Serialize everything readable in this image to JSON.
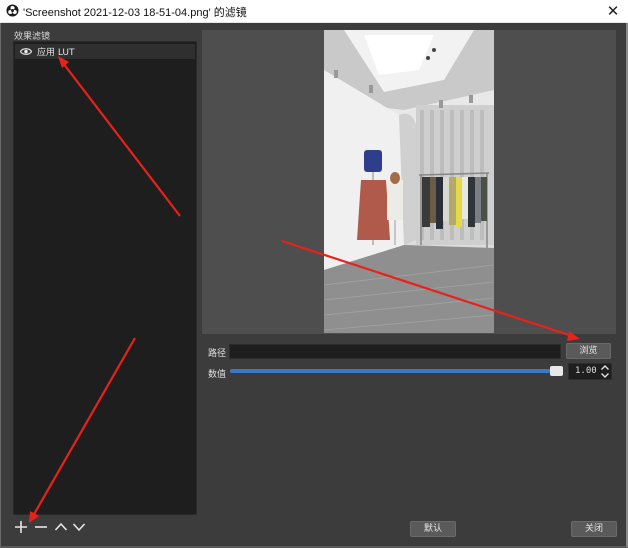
{
  "window": {
    "title": "'Screenshot 2021-12-03 18-51-04.png' 的滤镜",
    "close_glyph": "✕"
  },
  "effects_panel": {
    "label": "效果滤镜",
    "filters": [
      {
        "name": "应用 LUT",
        "visible_icon": "eye-icon"
      }
    ],
    "tools": [
      "add-icon",
      "remove-icon",
      "move-up-icon",
      "move-down-icon"
    ]
  },
  "properties": {
    "path_label": "路径",
    "path_value": "",
    "browse_label": "浏览",
    "value_label": "数值",
    "value": "1.00",
    "slider_level": 1.0
  },
  "footer": {
    "default_label": "默认",
    "close_label": "关闭"
  },
  "colors": {
    "annotation_arrow": "#e8221b",
    "slider_fill": "#3a78c9",
    "panel_bg": "#3c3c3c",
    "list_bg": "#1e1e1e"
  }
}
